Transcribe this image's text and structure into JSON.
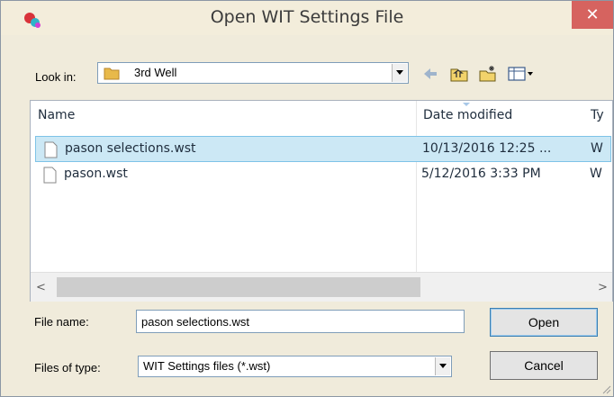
{
  "window": {
    "title": "Open WIT Settings File",
    "close_glyph": "✕"
  },
  "toolbar": {
    "look_in_label": "Look in:",
    "look_in_value": "3rd Well",
    "icons": [
      "back-arrow-icon",
      "up-folder-icon",
      "new-folder-icon",
      "view-menu-icon"
    ]
  },
  "file_list": {
    "columns": [
      "Name",
      "Date modified",
      "Ty"
    ],
    "rows": [
      {
        "name": "pason selections.wst",
        "date": "10/13/2016 12:25 ...",
        "type": "W",
        "selected": true
      },
      {
        "name": "pason.wst",
        "date": "5/12/2016 3:33 PM",
        "type": "W",
        "selected": false
      }
    ],
    "scroll_left_glyph": "<",
    "scroll_right_glyph": ">"
  },
  "form": {
    "file_name_label": "File name:",
    "file_name_value": "pason selections.wst",
    "file_type_label": "Files of type:",
    "file_type_value": "WIT Settings files (*.wst)"
  },
  "buttons": {
    "open": "Open",
    "cancel": "Cancel"
  },
  "colors": {
    "selection": "#cce8f5",
    "close_button": "#d6635f",
    "dialog_bg": "#f0ebdb"
  }
}
